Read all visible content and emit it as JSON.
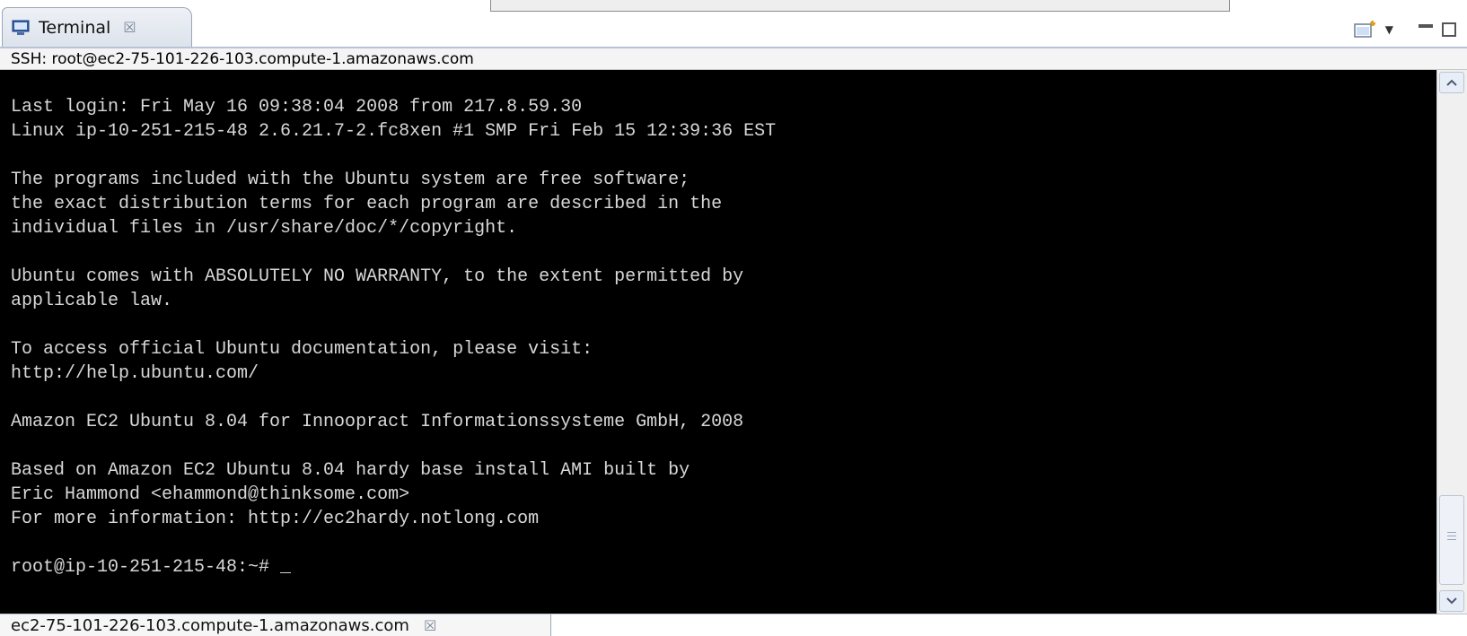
{
  "view_tab": {
    "label": "Terminal",
    "close": "☒",
    "icon": "terminal-icon"
  },
  "ssh_bar": {
    "label": "SSH: root@ec2-75-101-226-103.compute-1.amazonaws.com"
  },
  "terminal": {
    "lines": [
      "Last login: Fri May 16 09:38:04 2008 from 217.8.59.30",
      "Linux ip-10-251-215-48 2.6.21.7-2.fc8xen #1 SMP Fri Feb 15 12:39:36 EST",
      "",
      "The programs included with the Ubuntu system are free software;",
      "the exact distribution terms for each program are described in the",
      "individual files in /usr/share/doc/*/copyright.",
      "",
      "Ubuntu comes with ABSOLUTELY NO WARRANTY, to the extent permitted by",
      "applicable law.",
      "",
      "To access official Ubuntu documentation, please visit:",
      "http://help.ubuntu.com/",
      "",
      "Amazon EC2 Ubuntu 8.04 for Innoopract Informationssysteme GmbH, 2008",
      "",
      "Based on Amazon EC2 Ubuntu 8.04 hardy base install AMI built by",
      "Eric Hammond <ehammond@thinksome.com>",
      "For more information: http://ec2hardy.notlong.com",
      "",
      "root@ip-10-251-215-48:~# _"
    ],
    "background": "#000000",
    "foreground": "#d8d8d8"
  },
  "connection_tab": {
    "label": "ec2-75-101-226-103.compute-1.amazonaws.com",
    "close": "☒"
  },
  "view_actions": {
    "menu_glyph": "▼"
  }
}
